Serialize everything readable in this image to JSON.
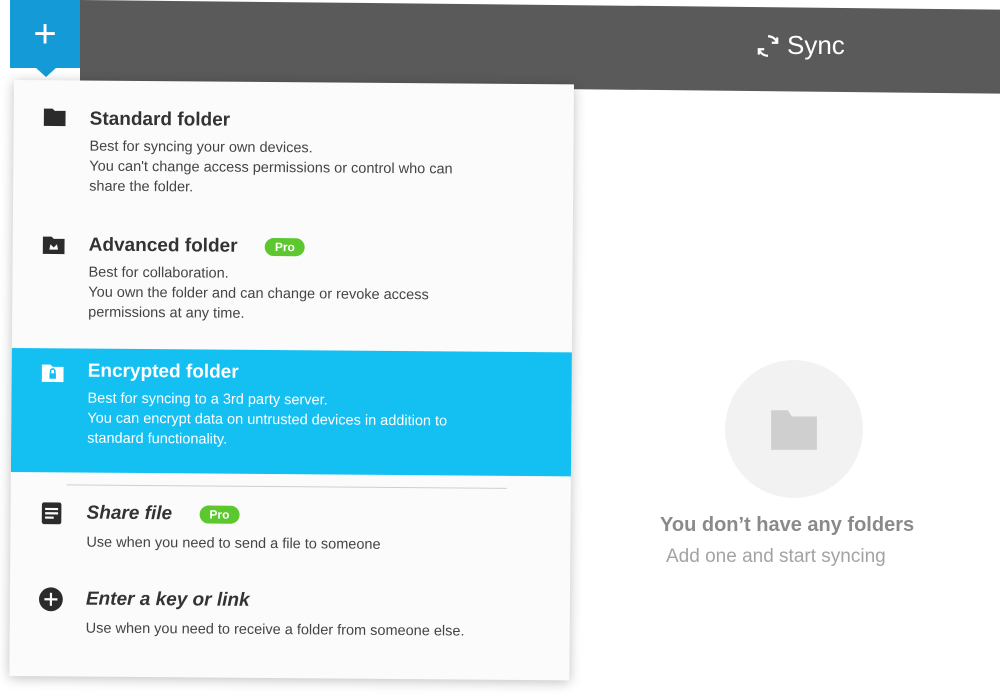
{
  "header": {
    "add_icon": "plus-icon",
    "sync_label": "Sync",
    "sync_icon": "sync-icon",
    "accent_color": "#149ad6",
    "bar_color": "#5a5a5a"
  },
  "menu": {
    "items": [
      {
        "title": "Standard folder",
        "line1": "Best for syncing your own devices.",
        "line2": "You can't change access permissions or control who can",
        "line3": "share the folder.",
        "icon": "folder-icon",
        "badge": ""
      },
      {
        "title": "Advanced folder",
        "line1": "Best for collaboration.",
        "line2": "You own the folder and can change or revoke access",
        "line3": "permissions at any time.",
        "icon": "crown-folder-icon",
        "badge": "Pro"
      },
      {
        "title": "Encrypted folder",
        "line1": "Best for syncing to a 3rd party server.",
        "line2": "You can encrypt data on untrusted devices in addition to",
        "line3": "standard functionality.",
        "icon": "lock-folder-icon",
        "badge": "",
        "selected_color": "#14bff2"
      },
      {
        "title": "Share file",
        "line1": "Use when you need to send a file to someone",
        "icon": "file-icon",
        "badge": "Pro"
      },
      {
        "title": "Enter a key or link",
        "line1": "Use when you need to receive a folder from someone else.",
        "icon": "plus-circle-icon",
        "badge": ""
      }
    ]
  },
  "empty_state": {
    "icon": "folder-icon",
    "title": "You don’t have any folders",
    "subtitle": "Add one and start syncing"
  }
}
